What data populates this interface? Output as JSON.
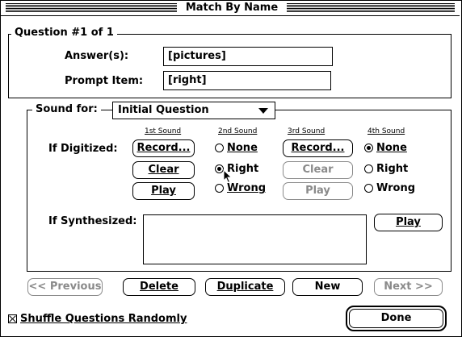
{
  "window": {
    "title": "Match By Name"
  },
  "question": {
    "legend": "Question #1 of 1",
    "answers_label": "Answer(s):",
    "answers_value": "[pictures]",
    "prompt_label": "Prompt Item:",
    "prompt_value": "[right]"
  },
  "sound": {
    "label": "Sound for:",
    "selected": "Initial Question",
    "headers": [
      "1st Sound",
      "2nd Sound",
      "3rd Sound",
      "4th Sound"
    ],
    "digitized_label": "If Digitized:",
    "set1": {
      "record": "Record...",
      "clear": "Clear",
      "play": "Play"
    },
    "radio2": {
      "none": "None",
      "right": "Right",
      "wrong": "Wrong",
      "selected": "Right"
    },
    "set3": {
      "record": "Record...",
      "clear": "Clear",
      "play": "Play"
    },
    "radio4": {
      "none": "None",
      "right": "Right",
      "wrong": "Wrong",
      "selected": "None"
    },
    "synth_label": "If Synthesized:",
    "synth_text": "",
    "synth_play": "Play"
  },
  "nav": {
    "previous": "<< Previous",
    "delete": "Delete",
    "duplicate": "Duplicate",
    "new": "New",
    "next": "Next >>"
  },
  "shuffle": {
    "label": "Shuffle Questions Randomly",
    "checked": true
  },
  "done": "Done"
}
